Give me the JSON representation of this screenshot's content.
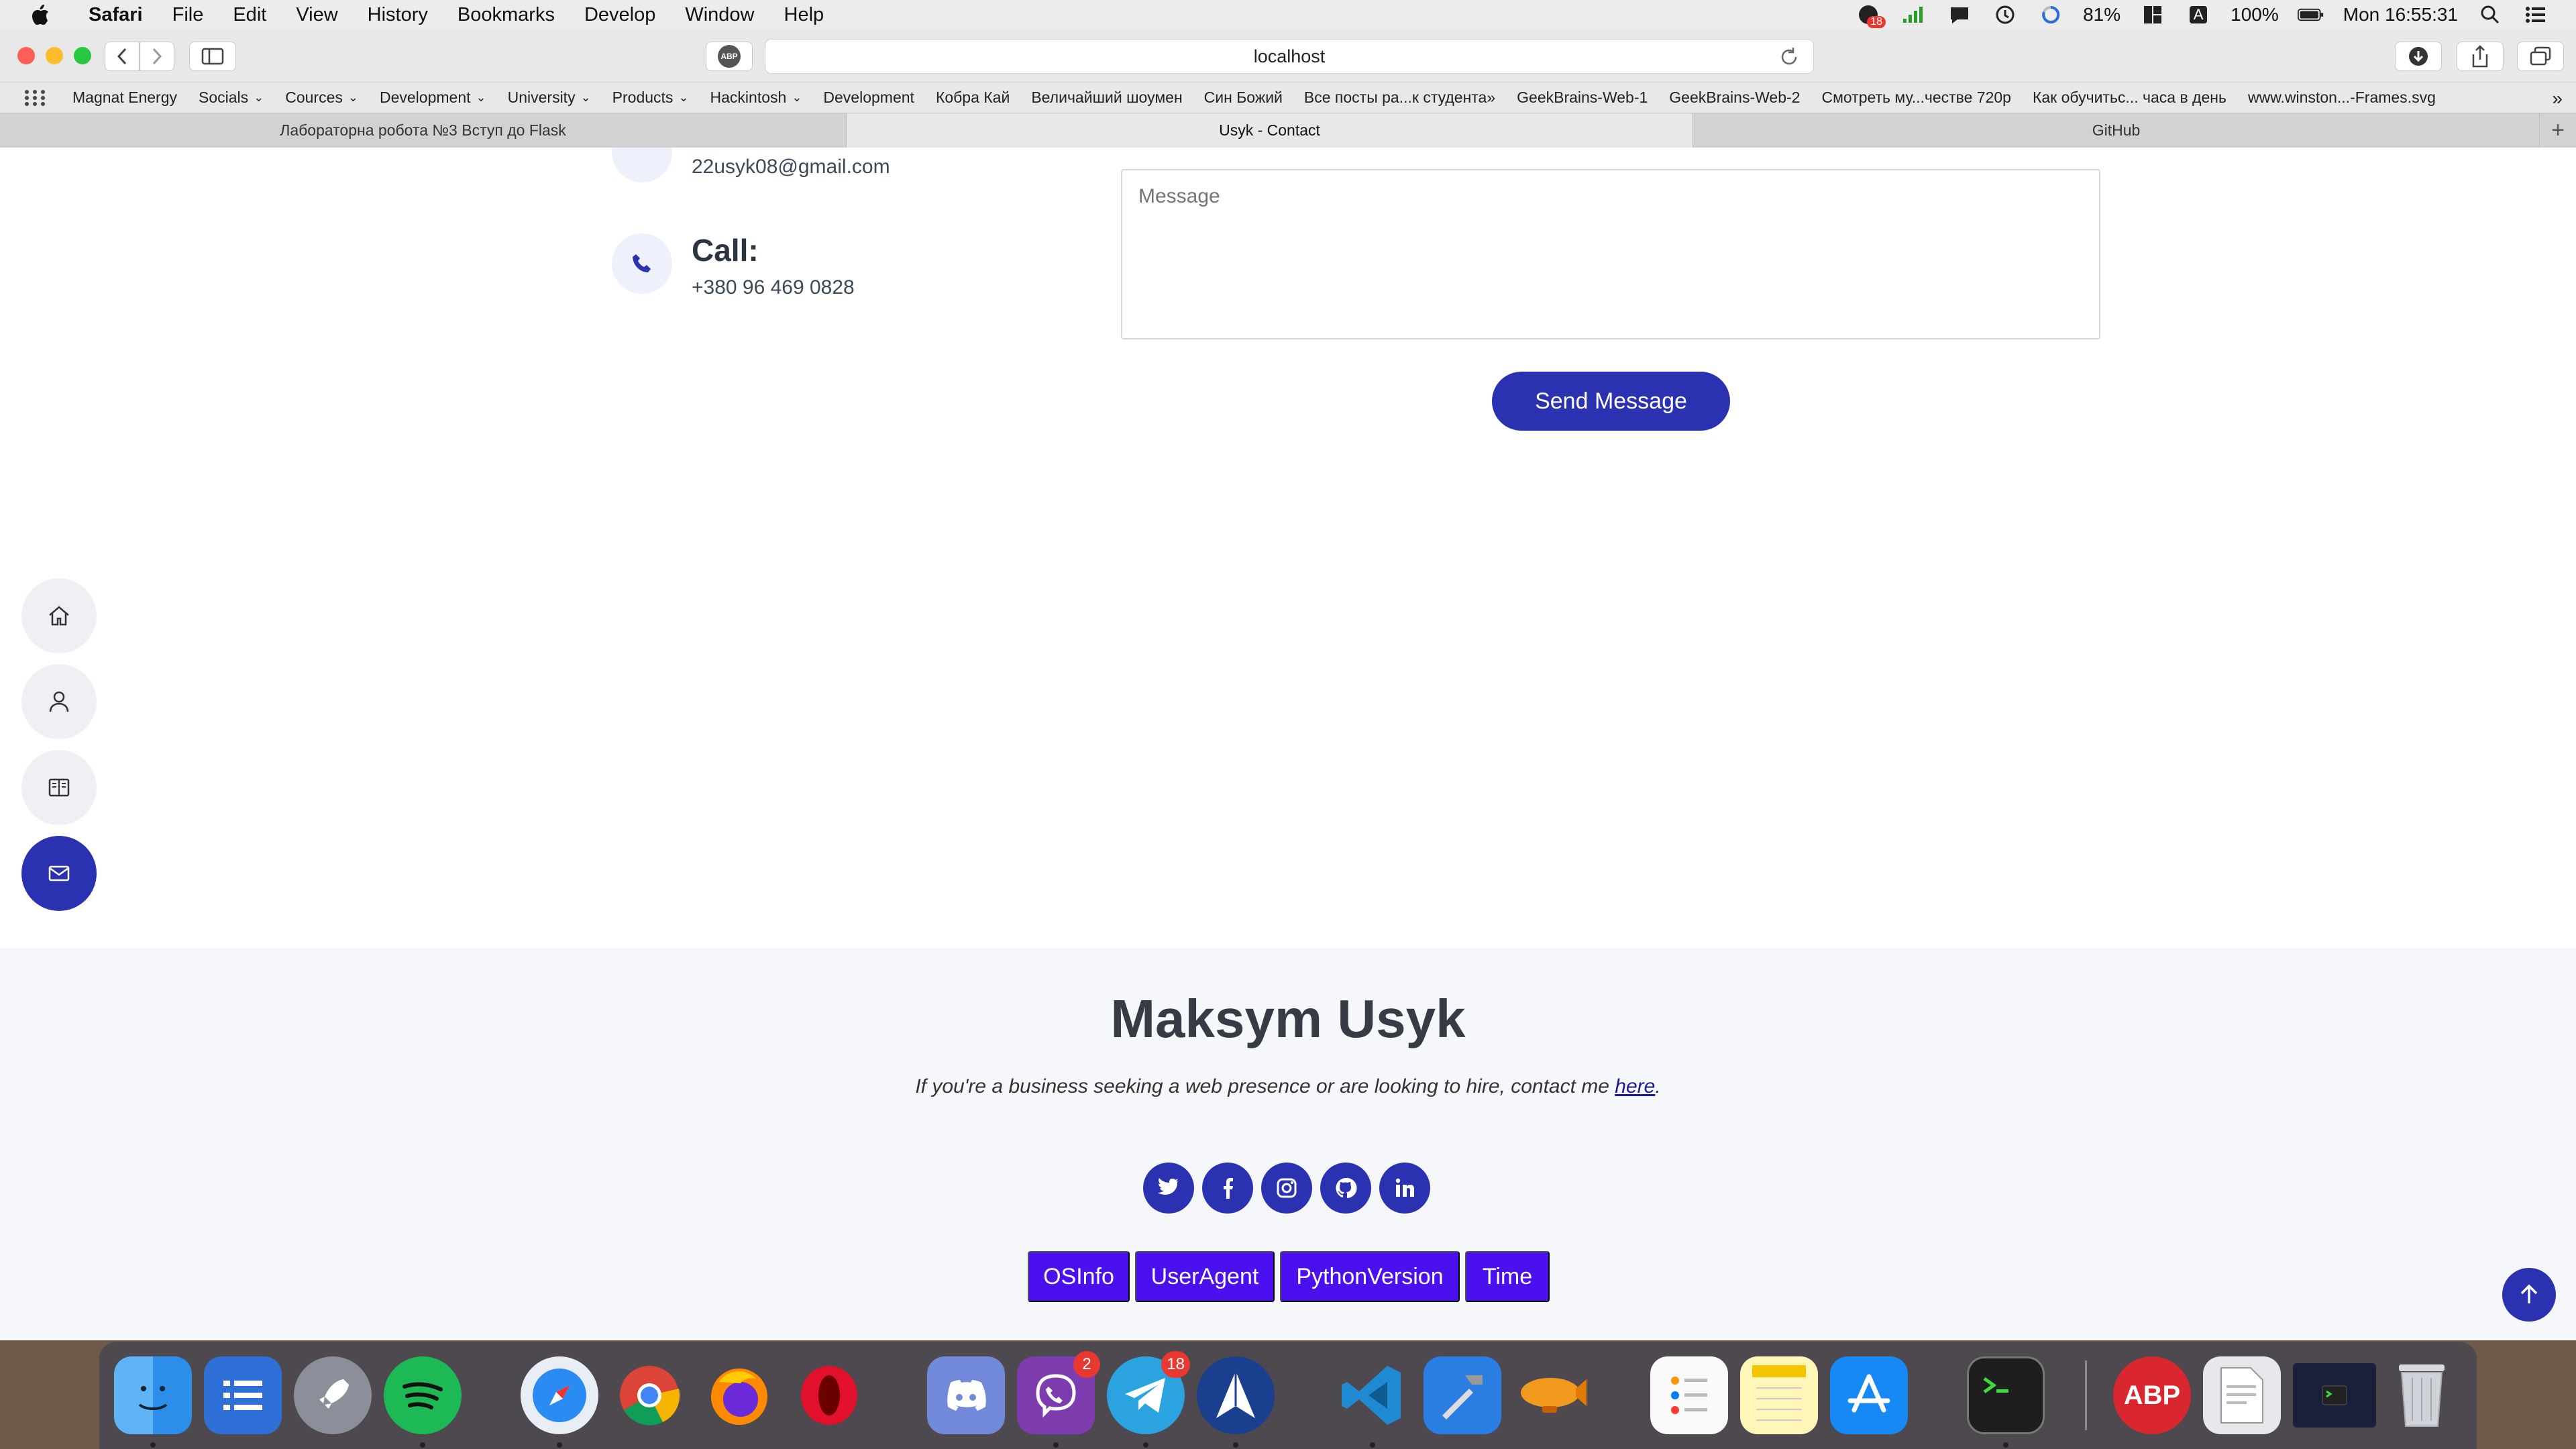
{
  "menubar": {
    "app": "Safari",
    "items": [
      "File",
      "Edit",
      "View",
      "History",
      "Bookmarks",
      "Develop",
      "Window",
      "Help"
    ],
    "battery_small": "81%",
    "battery": "100%",
    "clock": "Mon 16:55:31",
    "input_source": "A",
    "mail_badge": "18"
  },
  "toolbar": {
    "address": "localhost",
    "abp_label": "ABP"
  },
  "bookmarks": {
    "items": [
      {
        "label": "Magnat Energy",
        "folder": false
      },
      {
        "label": "Socials",
        "folder": true
      },
      {
        "label": "Cources",
        "folder": true
      },
      {
        "label": "Development",
        "folder": true
      },
      {
        "label": "University",
        "folder": true
      },
      {
        "label": "Products",
        "folder": true
      },
      {
        "label": "Hackintosh",
        "folder": true
      },
      {
        "label": "Development",
        "folder": false
      },
      {
        "label": "Кобра Кай",
        "folder": false
      },
      {
        "label": "Величайший шоумен",
        "folder": false
      },
      {
        "label": "Син Божий",
        "folder": false
      },
      {
        "label": "Все посты ра...к студента»",
        "folder": false
      },
      {
        "label": "GeekBrains-Web-1",
        "folder": false
      },
      {
        "label": "GeekBrains-Web-2",
        "folder": false
      },
      {
        "label": "Смотреть му...честве 720p",
        "folder": false
      },
      {
        "label": "Как обучитьс... часа в день",
        "folder": false
      },
      {
        "label": "www.winston...-Frames.svg",
        "folder": false
      }
    ],
    "more": "»"
  },
  "tabs": [
    {
      "label": "Лабораторна робота №3 Вступ до Flask",
      "active": false
    },
    {
      "label": "Usyk - Contact",
      "active": true
    },
    {
      "label": "GitHub",
      "active": false
    }
  ],
  "contact": {
    "email": "22usyk08@gmail.com",
    "call_title": "Call:",
    "phone": "+380 96 469 0828",
    "message_placeholder": "Message",
    "send_label": "Send Message"
  },
  "side_nav": [
    {
      "icon": "home-icon",
      "active": false
    },
    {
      "icon": "person-icon",
      "active": false
    },
    {
      "icon": "book-icon",
      "active": false
    },
    {
      "icon": "envelope-icon",
      "active": true
    }
  ],
  "footer": {
    "name": "Maksym Usyk",
    "tagline": "If you're a business seeking a web presence or are looking to hire, contact me ",
    "link": "here",
    "tag_end": ".",
    "socials": [
      "twitter-icon",
      "facebook-icon",
      "instagram-icon",
      "github-icon",
      "linkedin-icon"
    ],
    "info_buttons": [
      "OSInfo",
      "UserAgent",
      "PythonVersion",
      "Time"
    ]
  },
  "dock": {
    "viber_badge": "2",
    "telegram_badge": "18",
    "abp_label": "ABP"
  },
  "colors": {
    "accent": "#2b32b2",
    "info_button": "#4a10ee",
    "footer_bg": "#f5f7fa"
  }
}
